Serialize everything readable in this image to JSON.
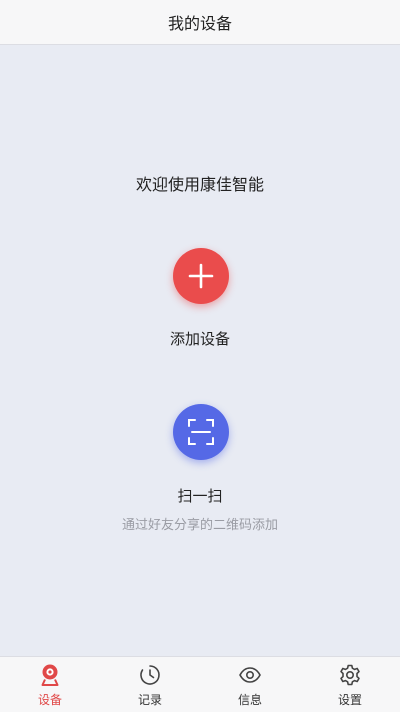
{
  "header": {
    "title": "我的设备"
  },
  "main": {
    "welcome": "欢迎使用康佳智能",
    "add_device": {
      "label": "添加设备",
      "icon": "plus-icon",
      "color": "#ea4c4c"
    },
    "scan": {
      "label": "扫一扫",
      "description": "通过好友分享的二维码添加",
      "icon": "scan-icon",
      "color": "#5569e6"
    }
  },
  "tabbar": {
    "active_color": "#e04848",
    "items": [
      {
        "label": "设备",
        "icon": "camera-pin-icon",
        "active": true
      },
      {
        "label": "记录",
        "icon": "clock-icon",
        "active": false
      },
      {
        "label": "信息",
        "icon": "eye-icon",
        "active": false
      },
      {
        "label": "设置",
        "icon": "gear-icon",
        "active": false
      }
    ]
  }
}
